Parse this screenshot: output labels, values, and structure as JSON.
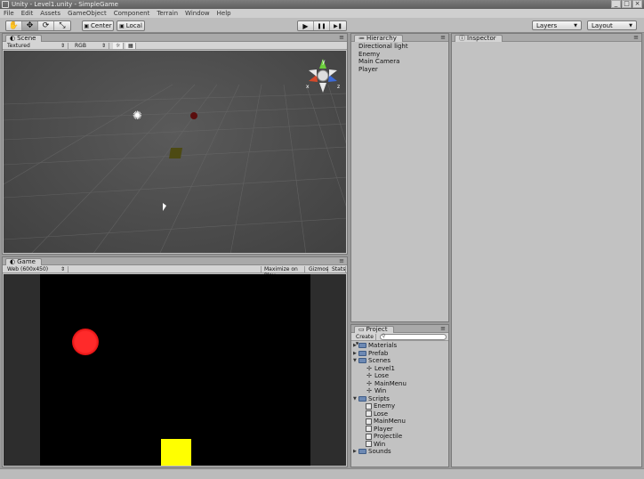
{
  "window": {
    "title": "Unity - Level1.unity - SimpleGame",
    "minimize_glyph": "_",
    "maximize_glyph": "□",
    "close_glyph": "×"
  },
  "menu": [
    "File",
    "Edit",
    "Assets",
    "GameObject",
    "Component",
    "Terrain",
    "Window",
    "Help"
  ],
  "toolbar": {
    "pivot_label": "Center",
    "space_label": "Local",
    "play_glyph": "▶",
    "pause_glyph": "❚❚",
    "step_glyph": "▶❚",
    "layers_label": "Layers",
    "layout_label": "Layout"
  },
  "scene": {
    "tab_label": "Scene",
    "render_mode": "Textured",
    "channel": "RGB",
    "gizmo_axes": {
      "x": "x",
      "y": "y",
      "z": "z"
    }
  },
  "game": {
    "tab_label": "Game",
    "resolution": "Web (600x450)",
    "maximize_label": "Maximize on Play",
    "gizmos_label": "Gizmos",
    "stats_label": "Stats",
    "enemy_color": "#ff1a1a",
    "player_color": "#ffff00"
  },
  "hierarchy": {
    "tab_label": "Hierarchy",
    "items": [
      "Directional light",
      "Enemy",
      "Main Camera",
      "Player"
    ]
  },
  "inspector": {
    "tab_label": "Inspector"
  },
  "project": {
    "tab_label": "Project",
    "create_label": "Create",
    "search_placeholder": "",
    "folders": [
      {
        "name": "Materials",
        "expanded": false,
        "children": []
      },
      {
        "name": "Prefab",
        "expanded": false,
        "children": []
      },
      {
        "name": "Scenes",
        "expanded": true,
        "children": [
          "Level1",
          "Lose",
          "MainMenu",
          "Win"
        ]
      },
      {
        "name": "Scripts",
        "expanded": true,
        "children": [
          "Enemy",
          "Lose",
          "MainMenu",
          "Player",
          "Projectile",
          "Win"
        ]
      },
      {
        "name": "Sounds",
        "expanded": false,
        "children": []
      }
    ]
  }
}
